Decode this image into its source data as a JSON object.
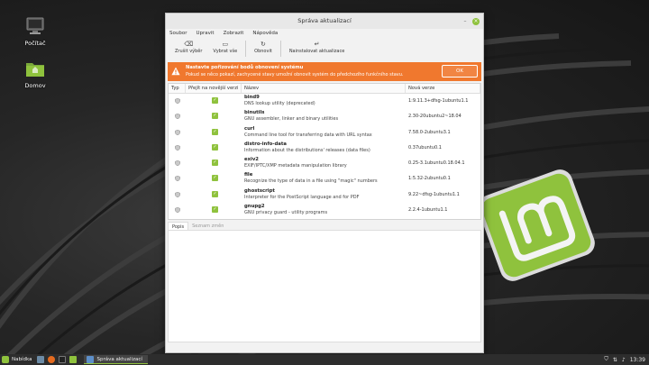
{
  "desktop": {
    "icons": [
      {
        "label": "Počítač",
        "icon": "computer-icon"
      },
      {
        "label": "Domov",
        "icon": "home-folder-icon"
      }
    ]
  },
  "window": {
    "title": "Správa aktualizací",
    "menu": [
      "Soubor",
      "Upravit",
      "Zobrazit",
      "Nápověda"
    ],
    "toolbar": [
      {
        "label": "Zrušit výběr",
        "icon": "clear-selection-icon"
      },
      {
        "label": "Vybrat vše",
        "icon": "select-all-icon"
      },
      {
        "label": "Obnovit",
        "icon": "refresh-icon"
      },
      {
        "label": "Nainstalovat aktualizace",
        "icon": "install-icon"
      }
    ],
    "infobar": {
      "title": "Nastavte pořizování bodů obnovení systému",
      "message": "Pokud se něco pokazí, zachycené stavy umožní obnovit systém do předchozího funkčního stavu.",
      "ok_label": "OK",
      "color": "#f0782e"
    },
    "table": {
      "headers": {
        "type": "Typ",
        "upgrade": "Přejít na novější verzi",
        "name": "Název",
        "version": "Nová verze"
      },
      "rows": [
        {
          "name": "bind9",
          "desc": "DNS lookup utility (deprecated)",
          "version": "1:9.11.3+dfsg-1ubuntu1.1"
        },
        {
          "name": "binutils",
          "desc": "GNU assembler, linker and binary utilities",
          "version": "2.30-20ubuntu2~18.04"
        },
        {
          "name": "curl",
          "desc": "Command line tool for transferring data with URL syntax",
          "version": "7.58.0-2ubuntu3.1"
        },
        {
          "name": "distro-info-data",
          "desc": "Information about the distributions' releases (data files)",
          "version": "0.37ubuntu0.1"
        },
        {
          "name": "exiv2",
          "desc": "EXIF/IPTC/XMP metadata manipulation library",
          "version": "0.25-3.1ubuntu0.18.04.1"
        },
        {
          "name": "file",
          "desc": "Recognize the type of data in a file using \"magic\" numbers",
          "version": "1:5.32-2ubuntu0.1"
        },
        {
          "name": "ghostscript",
          "desc": "Interpreter for the PostScript language and for PDF",
          "version": "9.22~dfsg-1ubuntu1.1"
        },
        {
          "name": "gnupg2",
          "desc": "GNU privacy guard - utility programs",
          "version": "2.2.4-1ubuntu1.1"
        }
      ]
    },
    "tabs": [
      "Popis",
      "Seznam změn"
    ]
  },
  "taskbar": {
    "menu_label": "Nabídka",
    "task_label": "Správa aktualizací",
    "clock": "13:39",
    "accent": "#8fc23d"
  }
}
